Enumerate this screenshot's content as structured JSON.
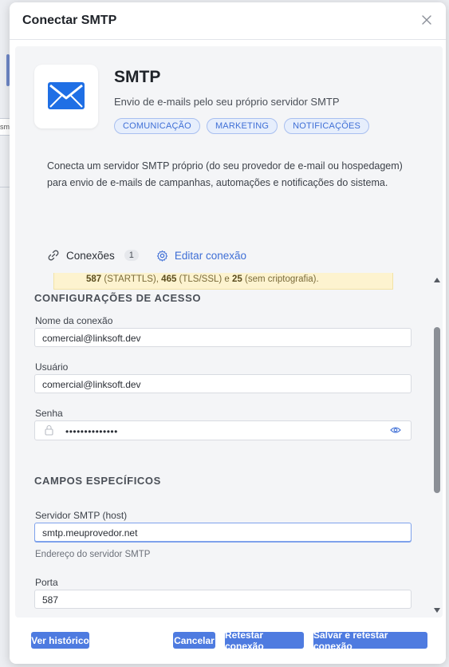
{
  "modal": {
    "title": "Conectar SMTP"
  },
  "app": {
    "name": "SMTP",
    "description": "Envio de e-mails pelo seu próprio servidor SMTP",
    "tags": [
      "COMUNICAÇÃO",
      "MARKETING",
      "NOTIFICAÇÕES"
    ],
    "long_description": "Conecta um servidor SMTP próprio (do seu provedor de e-mail ou hospedagem) para envio de e-mails de campanhas, automações e notificações do sistema.",
    "icon": "envelope-icon",
    "accent_color": "#3f6fd6"
  },
  "tabs": {
    "connections_label": "Conexões",
    "connections_count": "1",
    "edit_label": "Editar conexão"
  },
  "notice": {
    "p1_bold": "587",
    "p1": " (STARTTLS), ",
    "p2_bold": "465",
    "p2": " (TLS/SSL) e ",
    "p3_bold": "25",
    "p3": " (sem criptografia)."
  },
  "access": {
    "heading": "CONFIGURAÇÕES DE ACESSO",
    "connection_name_label": "Nome da conexão",
    "connection_name_value": "comercial@linksoft.dev",
    "user_label": "Usuário",
    "user_value": "comercial@linksoft.dev",
    "password_label": "Senha",
    "password_value": "••••••••••••••"
  },
  "specific": {
    "heading": "CAMPOS ESPECÍFICOS",
    "host_label": "Servidor SMTP (host)",
    "host_value": "smtp.meuprovedor.net",
    "host_help": "Endereço do servidor SMTP",
    "port_label": "Porta",
    "port_value": "587"
  },
  "footer": {
    "history": "Ver histórico",
    "cancel": "Cancelar",
    "retest": "Retestar conexão",
    "save_retest": "Salvar e retestar conexão"
  }
}
